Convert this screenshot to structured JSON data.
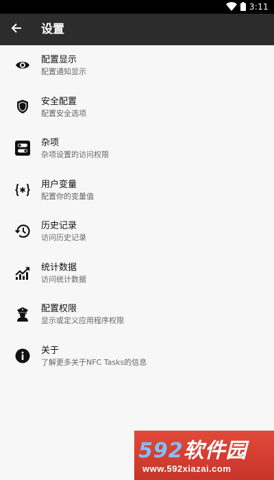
{
  "status_bar": {
    "time": "3:11",
    "icons": [
      "wifi-icon",
      "battery-icon"
    ]
  },
  "app_bar": {
    "title": "设置",
    "back_icon": "arrow-left-icon"
  },
  "settings": [
    {
      "title": "配置显示",
      "subtitle": "配置通知显示",
      "icon": "eye-icon"
    },
    {
      "title": "安全配置",
      "subtitle": "配置安全选项",
      "icon": "shield-icon"
    },
    {
      "title": "杂项",
      "subtitle": "杂项设置的访问权限",
      "icon": "toggles-icon"
    },
    {
      "title": "用户变量",
      "subtitle": "配置你的变量值",
      "icon": "variable-icon"
    },
    {
      "title": "历史记录",
      "subtitle": "访问历史记录",
      "icon": "history-icon"
    },
    {
      "title": "统计数据",
      "subtitle": "访问统计数据",
      "icon": "stats-icon"
    },
    {
      "title": "配置权限",
      "subtitle": "显示或定义应用程序权限",
      "icon": "police-icon"
    },
    {
      "title": "关于",
      "subtitle": "了解更多关于NFC Tasks的信息",
      "icon": "info-icon"
    }
  ],
  "watermark": {
    "digits": "592",
    "text": "软件园",
    "url": "www.592xiazai.com"
  },
  "colors": {
    "app_bar": "#2c2c2c",
    "status_bar": "#000000",
    "background": "#f7f7f7",
    "watermark": "#d13d31",
    "watermark_digits": "#7fc1ff"
  }
}
